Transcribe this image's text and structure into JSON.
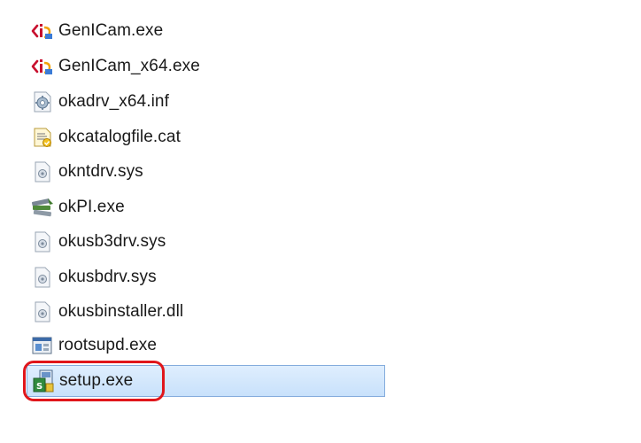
{
  "files": [
    {
      "name": "GenICam.exe",
      "icon": "genicam-exe-icon"
    },
    {
      "name": "GenICam_x64.exe",
      "icon": "genicam-exe-icon"
    },
    {
      "name": "okadrv_x64.inf",
      "icon": "inf-settings-icon"
    },
    {
      "name": "okcatalogfile.cat",
      "icon": "catalog-file-icon"
    },
    {
      "name": "okntdrv.sys",
      "icon": "system-file-icon"
    },
    {
      "name": "okPI.exe",
      "icon": "okpi-exe-icon"
    },
    {
      "name": "okusb3drv.sys",
      "icon": "system-file-icon"
    },
    {
      "name": "okusbdrv.sys",
      "icon": "system-file-icon"
    },
    {
      "name": "okusbinstaller.dll",
      "icon": "dll-file-icon"
    },
    {
      "name": "rootsupd.exe",
      "icon": "rootsupd-exe-icon"
    },
    {
      "name": "setup.exe",
      "icon": "setup-exe-icon",
      "selected": true
    }
  ],
  "colors": {
    "selection_fill": "#cce4fc",
    "selection_border": "#84acdd",
    "highlight_ring": "#e0161b",
    "text": "#1a1a1a"
  }
}
